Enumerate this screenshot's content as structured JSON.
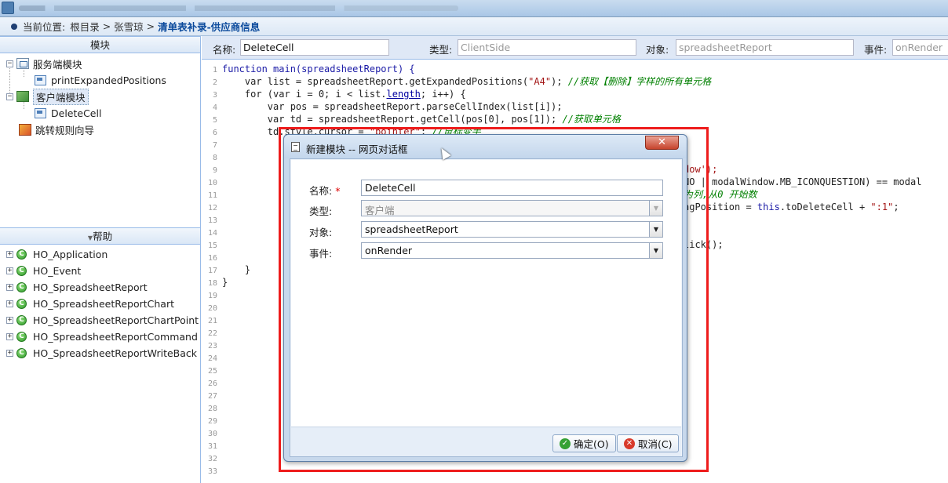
{
  "breadcrumb": {
    "label": "当前位置:",
    "root": "根目录",
    "sep1": " > ",
    "user": "张雪琼",
    "sep2": " > ",
    "current": "清单表补录-供应商信息"
  },
  "left_panel": {
    "title": "模块",
    "tree": [
      {
        "label": "服务端模块",
        "icon": "folder-icon",
        "expanded": true
      },
      {
        "label": "printExpandedPositions",
        "icon": "page-icon"
      },
      {
        "label": "客户端模块",
        "icon": "client-folder-icon",
        "expanded": true,
        "selected": true
      },
      {
        "label": "DeleteCell",
        "icon": "page-icon"
      },
      {
        "label": "跳转规则向导",
        "icon": "wizard-icon"
      }
    ]
  },
  "help_panel": {
    "title": "帮助",
    "items": [
      "HO_Application",
      "HO_Event",
      "HO_SpreadsheetReport",
      "HO_SpreadsheetReportChart",
      "HO_SpreadsheetReportChartPoint",
      "HO_SpreadsheetReportCommand",
      "HO_SpreadsheetReportWriteBack"
    ],
    "badge": "C"
  },
  "fields": {
    "name_label": "名称:",
    "name_value": "DeleteCell",
    "type_label": "类型:",
    "type_value": "ClientSide",
    "object_label": "对象:",
    "object_value": "spreadsheetReport",
    "event_label": "事件:",
    "event_value": "onRender"
  },
  "code": {
    "line_numbers": [
      "1",
      "2",
      "3",
      "4",
      "5",
      "6",
      "7",
      "8",
      "9",
      "10",
      "11",
      "12",
      "13",
      "14",
      "15",
      "16",
      "17",
      "18",
      "19",
      "20",
      "21",
      "22",
      "23",
      "24",
      "25",
      "26",
      "27",
      "28",
      "29",
      "30",
      "31",
      "32",
      "33"
    ],
    "l1": "function main(spreadsheetReport) {",
    "l2a": "    var list = spreadsheetReport.getExpandedPositions(",
    "l2b": "\"A4\"",
    "l2c": "); ",
    "l2d": "//获取【删除】字样的所有单元格",
    "l3a": "    for (var i = 0; i < list.",
    "l3b": "length",
    "l3c": "; i++) {",
    "l4": "        var pos = spreadsheetReport.parseCellIndex(list[i]);",
    "l5a": "        var td = spreadsheetReport.getCell(pos[0], pos[1]); ",
    "l5b": "//获取单元格",
    "l6a": "        td.style.cursor = ",
    "l6b": "\"pointer\"",
    "l6c": "; ",
    "l6d": "//鼠标变手",
    "l9": "dow');",
    "l10": "NO | modalWindow.MB_ICONQUESTION) == modal",
    "l11": "为列,从0 开始数",
    "l12a": "ngPosition = ",
    "l12b": "this",
    "l12c": ".toDeleteCell + ",
    "l12d": "\":1\"",
    "l12e": ";",
    "l15": "lick();",
    "l17": "    }",
    "l18": "}"
  },
  "dialog": {
    "title": "新建模块 -- 网页对话框",
    "close_symbol": "✕",
    "name_label": "名称:",
    "required_mark": "*",
    "name_value": "DeleteCell",
    "type_label": "类型:",
    "type_value": "客户端",
    "object_label": "对象:",
    "object_value": "spreadsheetReport",
    "event_label": "事件:",
    "event_value": "onRender",
    "ok_label": "确定(O)",
    "cancel_label": "取消(C)",
    "dropdown_arrow": "▼"
  }
}
